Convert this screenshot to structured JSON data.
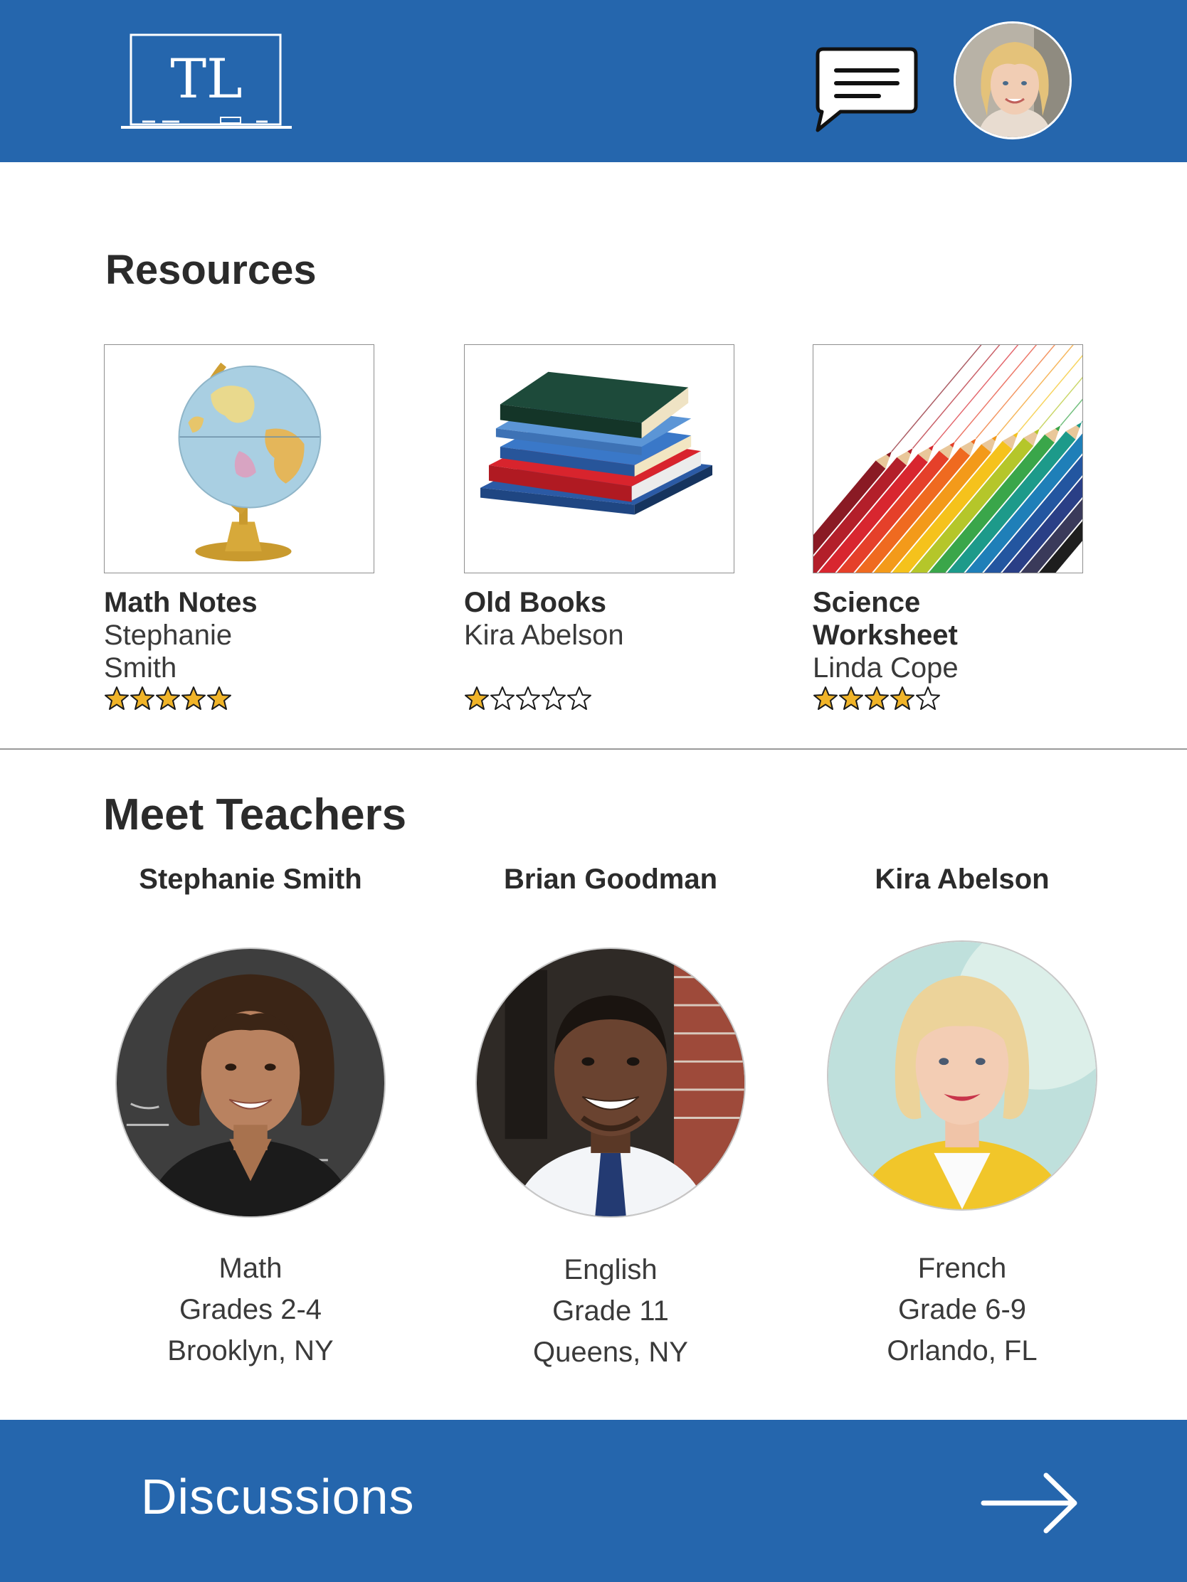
{
  "header": {
    "logo_text": "TL",
    "chat_icon": "chat-bubble-icon",
    "avatar": "user-avatar"
  },
  "resources": {
    "title": "Resources",
    "items": [
      {
        "title": "Math Notes",
        "author_line1": "Stephanie",
        "author_line2": "Smith",
        "rating": 5,
        "max_rating": 5,
        "thumbnail": "globe-image"
      },
      {
        "title": "Old Books",
        "author_line1": "Kira Abelson",
        "author_line2": "",
        "rating": 1,
        "max_rating": 5,
        "thumbnail": "books-image"
      },
      {
        "title_line1": "Science",
        "title_line2": "Worksheet",
        "author_line1": "Linda Cope",
        "rating": 4,
        "max_rating": 5,
        "thumbnail": "pencils-image"
      }
    ]
  },
  "teachers": {
    "title": "Meet Teachers",
    "items": [
      {
        "name": "Stephanie Smith",
        "subject": "Math",
        "grades": "Grades 2-4",
        "location": "Brooklyn, NY"
      },
      {
        "name": "Brian Goodman",
        "subject": "English",
        "grades": "Grade 11",
        "location": "Queens, NY"
      },
      {
        "name": "Kira Abelson",
        "subject": "French",
        "grades": "Grade 6-9",
        "location": "Orlando, FL"
      }
    ]
  },
  "footer": {
    "label": "Discussions",
    "icon": "arrow-right-icon"
  },
  "colors": {
    "brand_blue": "#2566ad",
    "star_gold": "#f0b429",
    "text_dark": "#2b2b2b"
  }
}
